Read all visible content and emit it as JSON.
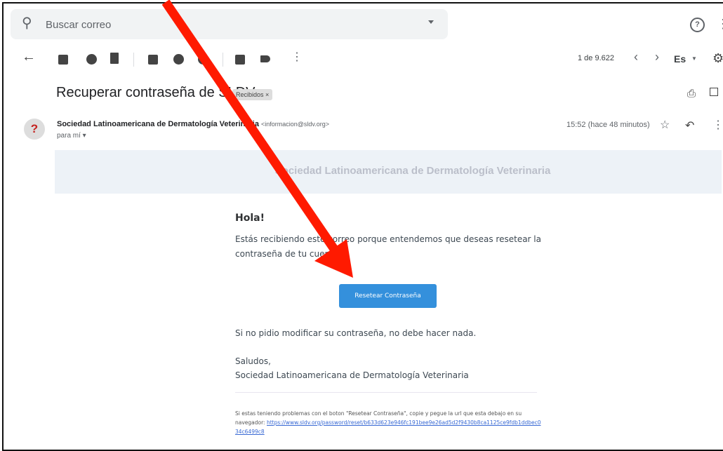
{
  "search": {
    "placeholder": "Buscar correo"
  },
  "toolbar": {
    "counter": "1 de 9.622",
    "language": "Es"
  },
  "email": {
    "subject": "Recuperar contraseña de SLDV",
    "label_chip": "Recibidos ×",
    "sender_name": "Sociedad Latinoamericana de Dermatología Veterinaria",
    "sender_email": "<informacion@sldv.org>",
    "recipient": "para mí ▾",
    "time": "15:52 (hace 48 minutos)",
    "avatar": "?"
  },
  "body": {
    "banner": "Sociedad Latinoamericana de Dermatología Veterinaria",
    "greeting": "Hola!",
    "intro": "Estás recibiendo este correo porque entendemos que deseas resetear la contraseña de tu cuenta.",
    "button": "Resetear Contraseña",
    "no_action": "Si no pidio modificar su contraseña, no debe hacer nada.",
    "salutation": "Saludos,",
    "signature": "Sociedad Latinoamericana de Dermatología Veterinaria",
    "footer_text": "Si estas teniendo problemas con el boton \"Resetear Contraseña\", copie y pegue la url que esta debajo en su navegador:",
    "reset_url": "https://www.sldv.org/password/reset/b633d623e946fc191bee9e26ad5d2f9430b8ca1125ce9fdb1ddbec034c6499c8"
  },
  "annotation": {
    "color": "#ff1a00"
  }
}
